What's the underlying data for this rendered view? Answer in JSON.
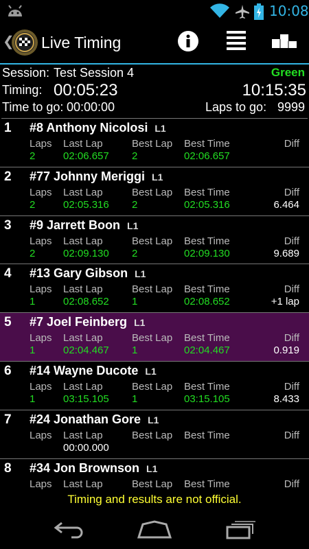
{
  "status_bar": {
    "time": "10:08"
  },
  "action_bar": {
    "title": "Live Timing"
  },
  "session": {
    "session_label": "Session:",
    "session_name": "Test Session 4",
    "flag": "Green",
    "timing_label": "Timing:",
    "timing_value": "00:05:23",
    "clock": "10:15:35",
    "time_to_go_label": "Time to go:",
    "time_to_go_value": "00:00:00",
    "laps_to_go_label": "Laps to go:",
    "laps_to_go_value": "9999"
  },
  "columns": {
    "laps": "Laps",
    "last_lap": "Last Lap",
    "best_lap": "Best Lap",
    "best_time": "Best Time",
    "diff": "Diff"
  },
  "rows": [
    {
      "pos": "1",
      "driver": "#8 Anthony Nicolosi",
      "class": "L1",
      "laps": "2",
      "last_lap": "02:06.657",
      "best_lap": "2",
      "best_time": "02:06.657",
      "diff": ""
    },
    {
      "pos": "2",
      "driver": "#77 Johnny Meriggi",
      "class": "L1",
      "laps": "2",
      "last_lap": "02:05.316",
      "best_lap": "2",
      "best_time": "02:05.316",
      "diff": "6.464"
    },
    {
      "pos": "3",
      "driver": "#9 Jarrett Boon",
      "class": "L1",
      "laps": "2",
      "last_lap": "02:09.130",
      "best_lap": "2",
      "best_time": "02:09.130",
      "diff": "9.689"
    },
    {
      "pos": "4",
      "driver": "#13 Gary Gibson",
      "class": "L1",
      "laps": "1",
      "last_lap": "02:08.652",
      "best_lap": "1",
      "best_time": "02:08.652",
      "diff": "+1 lap"
    },
    {
      "pos": "5",
      "driver": "#7 Joel Feinberg",
      "class": "L1",
      "laps": "1",
      "last_lap": "02:04.467",
      "best_lap": "1",
      "best_time": "02:04.467",
      "diff": "0.919"
    },
    {
      "pos": "6",
      "driver": "#14 Wayne Ducote",
      "class": "L1",
      "laps": "1",
      "last_lap": "03:15.105",
      "best_lap": "1",
      "best_time": "03:15.105",
      "diff": "8.433"
    },
    {
      "pos": "7",
      "driver": "#24 Jonathan Gore",
      "class": "L1",
      "laps": "",
      "last_lap": "00:00.000",
      "best_lap": "",
      "best_time": "",
      "diff": ""
    },
    {
      "pos": "8",
      "driver": "#34 Jon Brownson",
      "class": "L1",
      "laps": "",
      "last_lap": "",
      "best_lap": "",
      "best_time": "",
      "diff": ""
    }
  ],
  "footer_note": "Timing and results are not official.",
  "colors": {
    "accent": "#33b5e5",
    "green": "#22dd22",
    "highlight": "#4a0d4a",
    "note": "#ffff33"
  },
  "icons": [
    "android-icon",
    "wifi-icon",
    "airplane-icon",
    "battery-icon",
    "app-logo-icon",
    "info-icon",
    "list-icon",
    "podium-icon",
    "back-icon",
    "home-icon",
    "recents-icon"
  ]
}
